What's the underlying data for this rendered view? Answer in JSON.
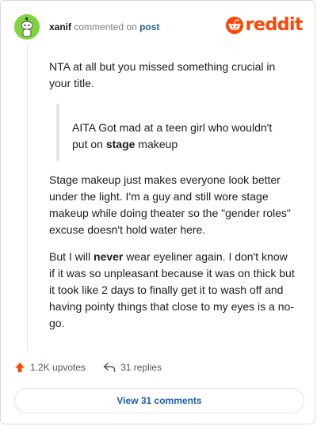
{
  "header": {
    "username": "xanif",
    "verb": "commented on",
    "post_link": "post",
    "logo_text": "reddit",
    "brand_color": "#ff4500"
  },
  "comment": {
    "p1": "NTA at all but you missed something crucial in your title.",
    "quote": {
      "before": "AITA Got mad at a teen girl who wouldn't put on ",
      "emphasis": "stage",
      "after": " makeup"
    },
    "p2": "Stage makeup just makes everyone look better under the light. I'm a guy and still wore stage makeup while doing theater so the \"gender roles\" excuse doesn't hold water here.",
    "p3": {
      "before": "But I will ",
      "emphasis": "never",
      "after": " wear eyeliner again. I don't know if it was so unpleasant because it was on thick but it took like 2 days to finally get it to wash off and having pointy things that close to my eyes is a no-go."
    }
  },
  "actions": {
    "upvotes": "1.2K upvotes",
    "replies": "31 replies",
    "upvote_icon": "upvote-arrow-icon",
    "reply_icon": "reply-arrow-icon"
  },
  "footer": {
    "view_comments": "View 31 comments"
  }
}
